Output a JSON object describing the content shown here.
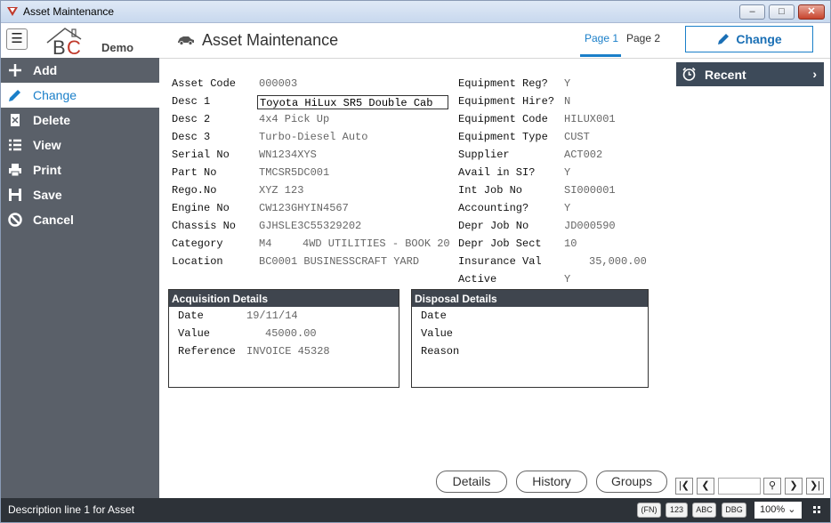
{
  "window": {
    "title": "Asset Maintenance"
  },
  "header": {
    "logo_demo": "Demo",
    "page_title": "Asset Maintenance",
    "tabs": [
      {
        "label": "Page 1"
      },
      {
        "label": "Page 2"
      }
    ],
    "change_button": "Change"
  },
  "sidebar": {
    "items": [
      {
        "label": "Add",
        "icon": "plus-icon"
      },
      {
        "label": "Change",
        "icon": "pencil-icon"
      },
      {
        "label": "Delete",
        "icon": "delete-icon"
      },
      {
        "label": "View",
        "icon": "list-icon"
      },
      {
        "label": "Print",
        "icon": "printer-icon"
      },
      {
        "label": "Save",
        "icon": "save-icon"
      },
      {
        "label": "Cancel",
        "icon": "cancel-icon"
      }
    ]
  },
  "form_left": [
    {
      "label": "Asset Code",
      "value": "000003"
    },
    {
      "label": "Desc 1",
      "value": "Toyota HiLux SR5 Double Cab"
    },
    {
      "label": "Desc 2",
      "value": "4x4 Pick Up"
    },
    {
      "label": "Desc 3",
      "value": "Turbo-Diesel Auto"
    },
    {
      "label": "Serial No",
      "value": "WN1234XYS"
    },
    {
      "label": "Part No",
      "value": "TMCSR5DC001"
    },
    {
      "label": "Rego.No",
      "value": "XYZ 123"
    },
    {
      "label": "Engine No",
      "value": "CW123GHYIN4567"
    },
    {
      "label": "Chassis No",
      "value": "GJHSLE3C55329202"
    },
    {
      "label": "Category",
      "value": "M4",
      "extra": "4WD UTILITIES - BOOK 20"
    },
    {
      "label": "Location",
      "value": "BC0001 BUSINESSCRAFT YARD"
    }
  ],
  "form_right": [
    {
      "label": "Equipment Reg?",
      "value": "Y"
    },
    {
      "label": "Equipment Hire?",
      "value": "N"
    },
    {
      "label": "Equipment Code",
      "value": "HILUX001"
    },
    {
      "label": "Equipment Type",
      "value": "CUST"
    },
    {
      "label": "Supplier",
      "value": "ACT002"
    },
    {
      "label": "Avail in SI?",
      "value": "Y"
    },
    {
      "label": "Int Job No",
      "value": "SI000001"
    },
    {
      "label": "Accounting?",
      "value": "Y"
    },
    {
      "label": "Depr Job No",
      "value": "JD000590"
    },
    {
      "label": "Depr Job Sect",
      "value": "10"
    },
    {
      "label": "Insurance Val",
      "value": "35,000.00"
    },
    {
      "label": "Active",
      "value": "Y"
    }
  ],
  "acquisition": {
    "title": "Acquisition Details",
    "rows": [
      {
        "label": "Date",
        "value": "19/11/14"
      },
      {
        "label": "Value",
        "value": "45000.00"
      },
      {
        "label": "Reference",
        "value": "INVOICE 45328"
      }
    ]
  },
  "disposal": {
    "title": "Disposal Details",
    "rows": [
      {
        "label": "Date",
        "value": ""
      },
      {
        "label": "Value",
        "value": ""
      },
      {
        "label": "Reason",
        "value": ""
      }
    ]
  },
  "recent": {
    "label": "Recent"
  },
  "bottom_buttons": {
    "details": "Details",
    "history": "History",
    "groups": "Groups"
  },
  "statusbar": {
    "text": "Description line 1 for Asset",
    "buttons": [
      "(FN)",
      "123",
      "ABC",
      "DBG"
    ],
    "zoom": "100%"
  },
  "colors": {
    "accent": "#1a7fc9",
    "sidebar_bg": "#5a6069",
    "status_bg": "#2d3238",
    "panel_head": "#3f454e"
  }
}
